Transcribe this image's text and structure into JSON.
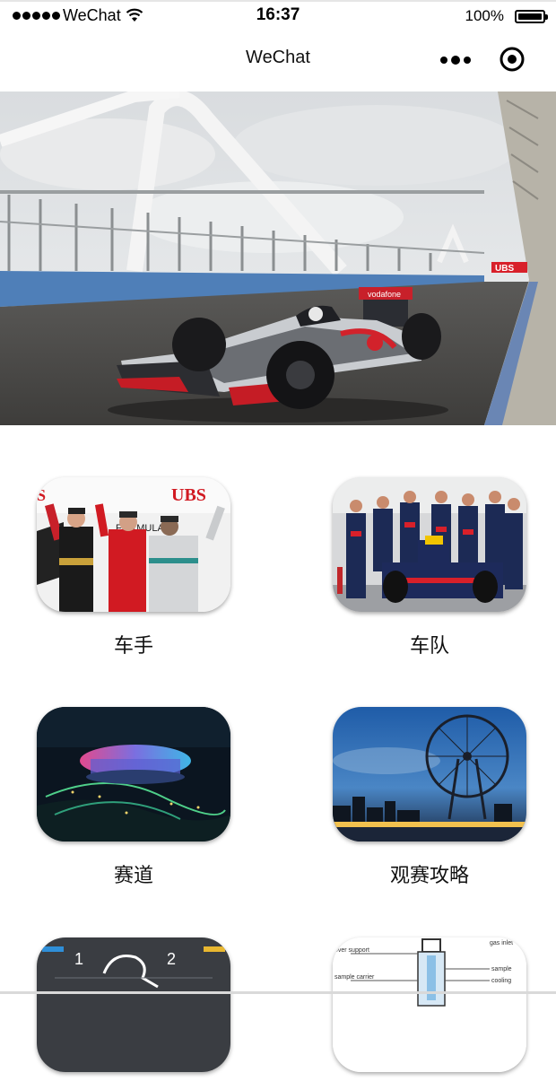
{
  "status_bar": {
    "carrier": "WeChat",
    "time": "16:37",
    "battery": "100%"
  },
  "nav": {
    "title": "WeChat"
  },
  "hero": {
    "sponsor_text": "vodafone",
    "banner_text": "UBS"
  },
  "grid": {
    "items": [
      {
        "label": "车手",
        "thumb": "drivers-podium"
      },
      {
        "label": "车队",
        "thumb": "team-pit-crew"
      },
      {
        "label": "赛道",
        "thumb": "circuit-night"
      },
      {
        "label": "观赛攻略",
        "thumb": "ferris-wheel-city"
      },
      {
        "label": "",
        "thumb": "steering-wheel-display"
      },
      {
        "label": "",
        "thumb": "technical-diagram"
      }
    ],
    "podium_banner": "UBS",
    "podium_text": "FORMULA",
    "diagram_labels": [
      "over support",
      "sample carrier",
      "sample",
      "cooling",
      "gas inlet"
    ],
    "dash_numbers": [
      "1",
      "2"
    ]
  }
}
